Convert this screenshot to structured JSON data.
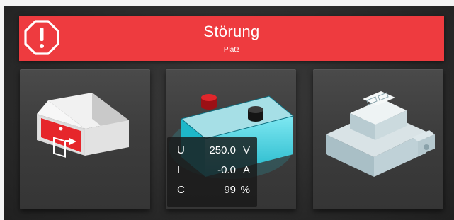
{
  "alarm": {
    "title": "Störung",
    "subtitle": "Platz",
    "color": "#ee3b3f"
  },
  "tiles": [
    {
      "name": "exit-sign",
      "icon": "emergency-exit-icon"
    },
    {
      "name": "battery",
      "icon": "battery-icon"
    },
    {
      "name": "module",
      "icon": "din-rail-module-icon"
    }
  ],
  "battery": {
    "readings": [
      {
        "label": "U",
        "value": "250.0",
        "unit": "V"
      },
      {
        "label": "I",
        "value": "-0.0",
        "unit": "A"
      },
      {
        "label": "C",
        "value": "99",
        "unit": "%"
      }
    ]
  }
}
